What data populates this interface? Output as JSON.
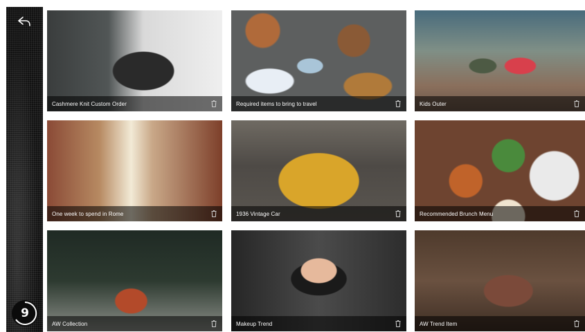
{
  "sidebar": {
    "back_icon": "reply-arrow-icon",
    "counter": "9"
  },
  "cards": [
    {
      "title": "Cashmere Knit Custom Order",
      "icon": "trash-icon"
    },
    {
      "title": "Required items to bring to travel",
      "icon": "trash-icon"
    },
    {
      "title": "Kids Outer",
      "icon": "trash-icon"
    },
    {
      "title": "One week to spend in Rome",
      "icon": "trash-icon"
    },
    {
      "title": "1936 Vintage Car",
      "icon": "trash-icon"
    },
    {
      "title": "Recommended Brunch Menu",
      "icon": "trash-icon"
    },
    {
      "title": "AW Collection",
      "icon": "trash-icon"
    },
    {
      "title": "Makeup Trend",
      "icon": "trash-icon"
    },
    {
      "title": "AW Trend Item",
      "icon": "trash-icon"
    }
  ],
  "colors": {
    "caption_bar": "#000000",
    "caption_text": "#ffffff",
    "sidebar": "#1a1a1a"
  }
}
